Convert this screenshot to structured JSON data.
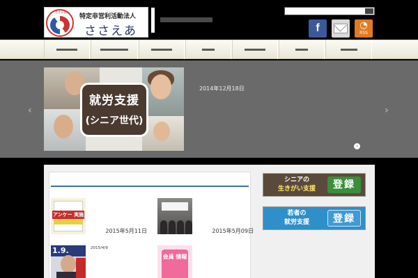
{
  "header": {
    "org_type": "特定非営利活動法人",
    "org_name": "ささえあい",
    "logo_ring_text": "ささえあい",
    "fb_label": "f",
    "rss_label": "RSS"
  },
  "nav": {
    "items": [
      {
        "id": "item-1",
        "label": ""
      },
      {
        "id": "item-2",
        "label": ""
      },
      {
        "id": "item-3",
        "label": ""
      },
      {
        "id": "item-4",
        "label": ""
      },
      {
        "id": "item-5",
        "label": ""
      },
      {
        "id": "item-6",
        "label": ""
      },
      {
        "id": "item-7",
        "label": ""
      }
    ]
  },
  "slider": {
    "badge_line1": "就労支援",
    "badge_line2": "(シニア世代)",
    "title": "",
    "date": "2014年12月18日",
    "excerpt": "",
    "more": ""
  },
  "main": {
    "section_title": "",
    "posts": [
      {
        "title": "",
        "date": "2015年5月11日",
        "thumb": "アンケー 実施し"
      },
      {
        "title": "",
        "date": "2015年5月09日",
        "thumb": ""
      },
      {
        "title": "2015/4/9",
        "date": "",
        "thumb": "1.9."
      },
      {
        "title": "",
        "date": "",
        "thumb": "会員 情報"
      }
    ]
  },
  "sidebar": {
    "banner1_line1": "シニアの",
    "banner1_line2": "生きがい支援",
    "banner1_btn": "登録",
    "banner2_line1": "若者の",
    "banner2_line2": "就労支援",
    "banner2_btn": "登録"
  },
  "colors": {
    "accent": "#3e6ea8",
    "slider_bg": "#6a6a6a",
    "facebook": "#3b5998",
    "rss": "#e07b22"
  }
}
